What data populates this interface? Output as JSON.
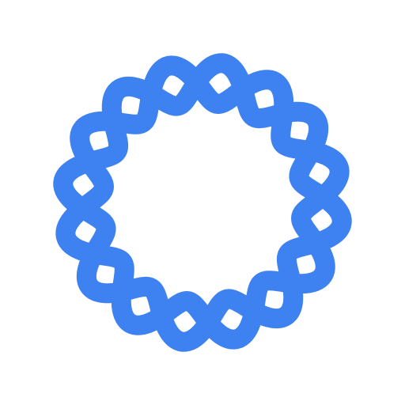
{
  "logo": {
    "icon": "interwoven-ring-logo-icon",
    "stroke_color": "#3D82F0",
    "background_color": "#FFFFFF",
    "lobes": 8
  }
}
